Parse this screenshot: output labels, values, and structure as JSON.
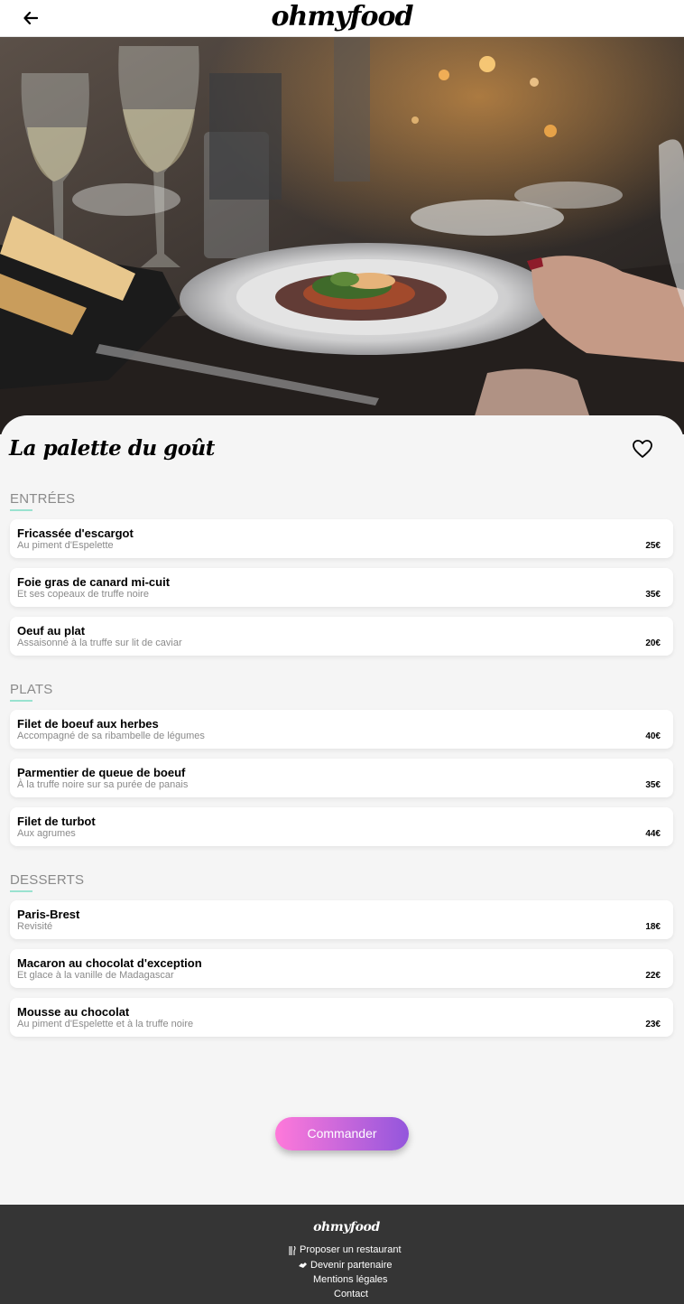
{
  "header": {
    "back_icon": "arrow-left-icon",
    "brand": "ohmyfood"
  },
  "hero": {
    "description_icon": "restaurant-photo"
  },
  "restaurant": {
    "name": "La palette du goût",
    "favorite_icon": "heart-outline-icon"
  },
  "sections": [
    {
      "title": "ENTRÉES",
      "items": [
        {
          "name": "Fricassée d'escargot",
          "description": "Au piment d'Espelette",
          "price": "25€"
        },
        {
          "name": "Foie gras de canard mi-cuit",
          "description": "Et ses copeaux de truffe noire",
          "price": "35€"
        },
        {
          "name": "Oeuf au plat",
          "description": "Assaisonné à la truffe sur lit de caviar",
          "price": "20€"
        }
      ]
    },
    {
      "title": "PLATS",
      "items": [
        {
          "name": "Filet de boeuf aux herbes",
          "description": "Accompagné de sa ribambelle de légumes",
          "price": "40€"
        },
        {
          "name": "Parmentier de queue de boeuf",
          "description": "À la truffe noire sur sa purée de panais",
          "price": "35€"
        },
        {
          "name": "Filet de turbot",
          "description": "Aux agrumes",
          "price": "44€"
        }
      ]
    },
    {
      "title": "DESSERTS",
      "items": [
        {
          "name": "Paris-Brest",
          "description": "Revisité",
          "price": "18€"
        },
        {
          "name": "Macaron au chocolat d'exception",
          "description": "Et glace à la vanille de Madagascar",
          "price": "22€"
        },
        {
          "name": "Mousse au chocolat",
          "description": "Au piment d'Espelette et à la truffe noire",
          "price": "23€"
        }
      ]
    }
  ],
  "order_button": {
    "label": "Commander"
  },
  "footer": {
    "brand": "ohmyfood",
    "links": [
      {
        "icon": "utensils-icon",
        "label": "Proposer un restaurant"
      },
      {
        "icon": "handshake-icon",
        "label": "Devenir partenaire"
      },
      {
        "label": "Mentions légales"
      },
      {
        "label": "Contact"
      }
    ]
  },
  "colors": {
    "accent_gradient_start": "#ff79da",
    "accent_gradient_end": "#9356dc",
    "section_underline": "#99e2d0",
    "footer_background": "#353535",
    "page_background": "#f5f5f5"
  }
}
